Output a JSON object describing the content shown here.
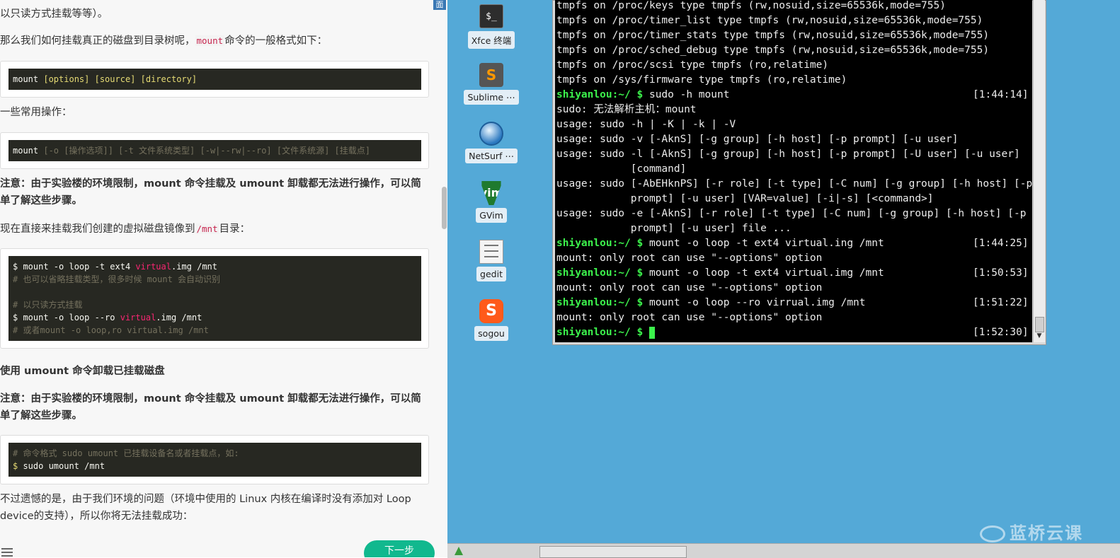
{
  "doc": {
    "top_fragment": "以只读方式挂载等等）。",
    "para_mount_format_1": "那么我们如何挂载真正的磁盘到目录树呢，",
    "para_mount_format_code": "mount",
    "para_mount_format_2": "命令的一般格式如下：",
    "code1": {
      "cmd": "mount",
      "args": " [options] [source] [directory]"
    },
    "common_ops": "一些常用操作：",
    "code2": {
      "cmd": "mount",
      "args": " [-o [操作选项]] [-t 文件系统类型] [-w|--rw|--ro] [文件系统源] [挂载点]"
    },
    "note1": "注意：由于实验楼的环境限制，mount 命令挂载及 umount 卸载都无法进行操作，可以简单了解这些步骤。",
    "para_mount_now_1": "现在直接来挂载我们创建的虚拟磁盘镜像到",
    "para_mount_now_code": "/mnt",
    "para_mount_now_2": "目录：",
    "code3": {
      "l1_a": "$ mount -o loop -t ext4 ",
      "l1_b": "virtual",
      "l1_c": ".img /mnt",
      "l2": "# 也可以省略挂载类型，很多时候 mount 会自动识别",
      "l4": "# 以只读方式挂载",
      "l5_a": "$ mount -o loop --ro ",
      "l5_b": "virtual",
      "l5_c": ".img /mnt",
      "l6": "# 或者mount -o loop,ro virtual.img /mnt"
    },
    "heading_umount": "使用 umount 命令卸载已挂载磁盘",
    "note2": "注意：由于实验楼的环境限制，mount 命令挂载及 umount 卸载都无法进行操作，可以简单了解这些步骤。",
    "code4": {
      "l1": "# 命令格式 sudo umount 已挂载设备名或者挂载点，如:",
      "l2_a": "$",
      "l2_b": " sudo umount /mnt"
    },
    "para_last": "不过遗憾的是，由于我们环境的问题（环境中使用的 Linux 内核在编译时没有添加对 Loop device的支持），所以你将无法挂载成功：",
    "next_button": "下一步",
    "sidebar_tab": "面"
  },
  "desktop": {
    "icons": [
      {
        "label": "Xfce 终端",
        "glyph": "$_"
      },
      {
        "label": "Sublime ⋯",
        "glyph": "S"
      },
      {
        "label": "NetSurf ⋯",
        "glyph": ""
      },
      {
        "label": "GVim",
        "glyph": "vim"
      },
      {
        "label": "gedit",
        "glyph": ""
      },
      {
        "label": "sogou",
        "glyph": "S"
      }
    ],
    "watermark": "蓝桥云课"
  },
  "terminal": {
    "prompt_user": "shiyanlou",
    "prompt_path": ":~/ $ ",
    "lines": [
      "tmpfs on /proc/keys type tmpfs (rw,nosuid,size=65536k,mode=755)",
      "tmpfs on /proc/timer_list type tmpfs (rw,nosuid,size=65536k,mode=755)",
      "tmpfs on /proc/timer_stats type tmpfs (rw,nosuid,size=65536k,mode=755)",
      "tmpfs on /proc/sched_debug type tmpfs (rw,nosuid,size=65536k,mode=755)",
      "tmpfs on /proc/scsi type tmpfs (ro,relatime)",
      "tmpfs on /sys/firmware type tmpfs (ro,relatime)",
      "sudo -h mount",
      "sudo: 无法解析主机：mount",
      "usage: sudo -h | -K | -k | -V",
      "usage: sudo -v [-AknS] [-g group] [-h host] [-p prompt] [-u user]",
      "usage: sudo -l [-AknS] [-g group] [-h host] [-p prompt] [-U user] [-u user]",
      "            [command]",
      "usage: sudo [-AbEHknPS] [-r role] [-t type] [-C num] [-g group] [-h host] [-p",
      "            prompt] [-u user] [VAR=value] [-i|-s] [<command>]",
      "usage: sudo -e [-AknS] [-r role] [-t type] [-C num] [-g group] [-h host] [-p",
      "            prompt] [-u user] file ...",
      "mount -o loop -t ext4 virtual.ing /mnt",
      "mount: only root can use \"--options\" option",
      "mount -o loop -t ext4 virtual.img /mnt",
      "mount: only root can use \"--options\" option",
      "mount -o loop --ro virrual.img /mnt",
      "mount: only root can use \"--options\" option",
      ""
    ],
    "times": {
      "t6": "[1:44:14]",
      "t16": "[1:44:25]",
      "t18": "[1:50:53]",
      "t20": "[1:51:22]",
      "t22": "[1:52:30]"
    }
  }
}
